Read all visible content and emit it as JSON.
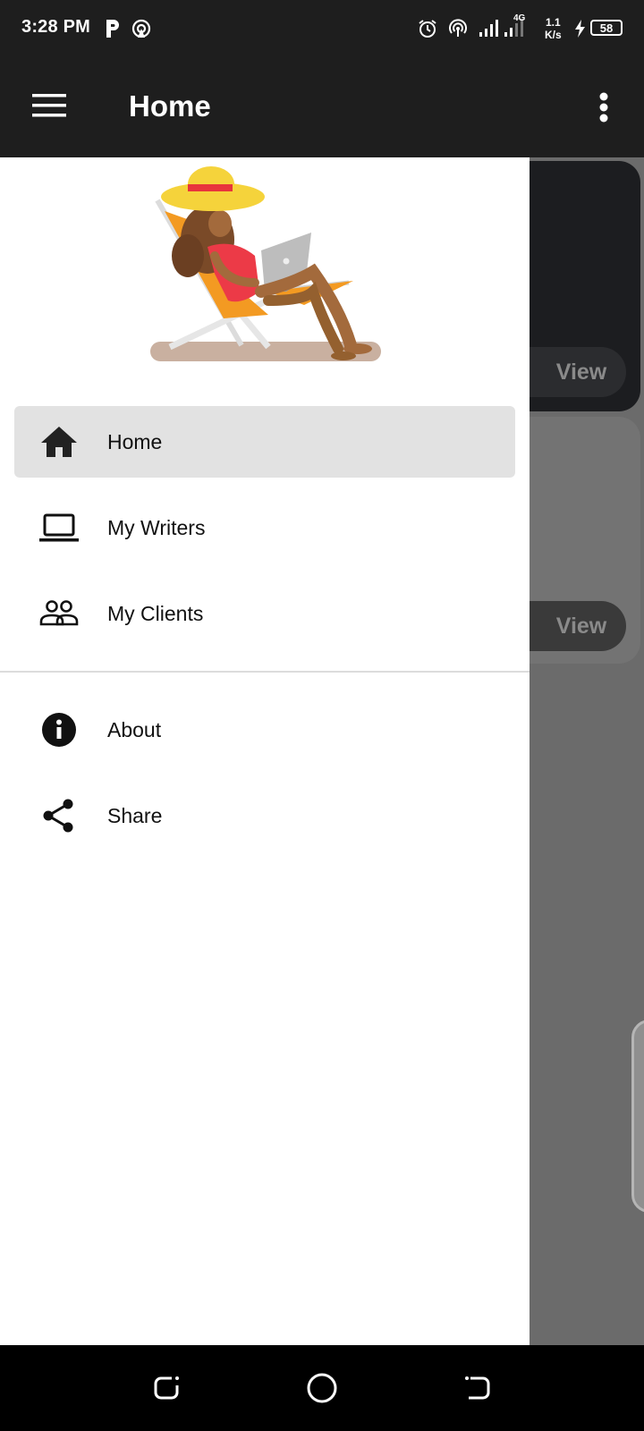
{
  "status_bar": {
    "time": "3:28 PM",
    "net_speed_value": "1.1",
    "net_speed_unit": "K/s",
    "network_type": "4G",
    "battery": "58"
  },
  "app_bar": {
    "title": "Home"
  },
  "drawer": {
    "nav_items": [
      {
        "label": "Home",
        "icon": "home-icon",
        "active": true
      },
      {
        "label": "My Writers",
        "icon": "laptop-icon",
        "active": false
      },
      {
        "label": "My Clients",
        "icon": "people-icon",
        "active": false
      }
    ],
    "secondary_items": [
      {
        "label": "About",
        "icon": "info-icon"
      },
      {
        "label": "Share",
        "icon": "share-icon"
      }
    ]
  },
  "background_cards": [
    {
      "button_label": "View"
    },
    {
      "button_label": "View"
    }
  ],
  "colors": {
    "app_bar": "#1e1e1e",
    "scrim": "#6b6b6b",
    "drawer_bg": "#ffffff",
    "active_item_bg": "#e2e2e2"
  }
}
